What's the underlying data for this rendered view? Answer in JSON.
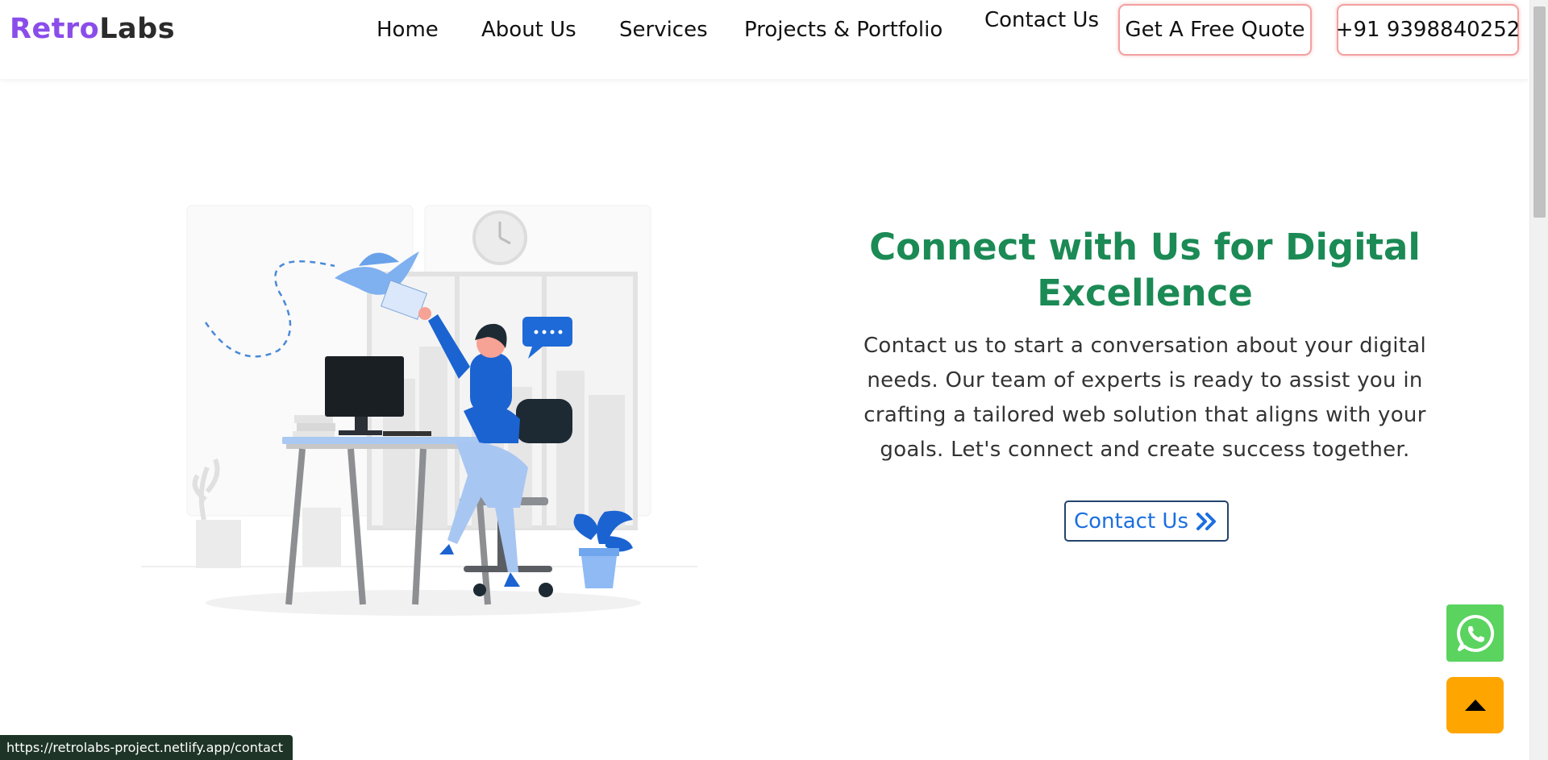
{
  "brand": {
    "part1": "Retro",
    "part2": "Labs"
  },
  "nav": {
    "home": "Home",
    "about": "About Us",
    "services": "Services",
    "projects": "Projects & Portfolio",
    "contact": "Contact Us",
    "quote_button": "Get A Free Quote",
    "phone_button": "+91 9398840252"
  },
  "hero": {
    "title": "Connect with Us for Digital Excellence",
    "description": "Contact us to start a conversation about your digital needs. Our team of experts is ready to assist you in crafting a tailored web solution that aligns with your goals. Let's connect and create success together.",
    "cta_label": "Contact Us",
    "cta_icon": "double-chevron-right-icon"
  },
  "floating": {
    "whatsapp_icon": "whatsapp-icon",
    "scroll_top_icon": "caret-up-icon"
  },
  "status_bar": {
    "url": "https://retrolabs-project.netlify.app/contact"
  },
  "colors": {
    "brand_primary": "#8a4dea",
    "title_green": "#1b8a55",
    "link_blue": "#1b6fe0",
    "whatsapp_green": "#5ad35f",
    "scroll_top_orange": "#ffa500",
    "button_border_red": "#f3a0a0"
  }
}
